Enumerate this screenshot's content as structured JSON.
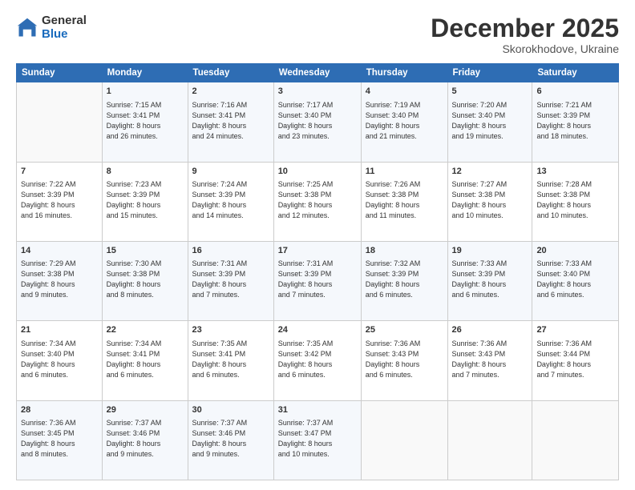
{
  "logo": {
    "general": "General",
    "blue": "Blue"
  },
  "title": "December 2025",
  "subtitle": "Skorokhodove, Ukraine",
  "days_header": [
    "Sunday",
    "Monday",
    "Tuesday",
    "Wednesday",
    "Thursday",
    "Friday",
    "Saturday"
  ],
  "weeks": [
    [
      {
        "day": "",
        "content": ""
      },
      {
        "day": "1",
        "content": "Sunrise: 7:15 AM\nSunset: 3:41 PM\nDaylight: 8 hours\nand 26 minutes."
      },
      {
        "day": "2",
        "content": "Sunrise: 7:16 AM\nSunset: 3:41 PM\nDaylight: 8 hours\nand 24 minutes."
      },
      {
        "day": "3",
        "content": "Sunrise: 7:17 AM\nSunset: 3:40 PM\nDaylight: 8 hours\nand 23 minutes."
      },
      {
        "day": "4",
        "content": "Sunrise: 7:19 AM\nSunset: 3:40 PM\nDaylight: 8 hours\nand 21 minutes."
      },
      {
        "day": "5",
        "content": "Sunrise: 7:20 AM\nSunset: 3:40 PM\nDaylight: 8 hours\nand 19 minutes."
      },
      {
        "day": "6",
        "content": "Sunrise: 7:21 AM\nSunset: 3:39 PM\nDaylight: 8 hours\nand 18 minutes."
      }
    ],
    [
      {
        "day": "7",
        "content": "Sunrise: 7:22 AM\nSunset: 3:39 PM\nDaylight: 8 hours\nand 16 minutes."
      },
      {
        "day": "8",
        "content": "Sunrise: 7:23 AM\nSunset: 3:39 PM\nDaylight: 8 hours\nand 15 minutes."
      },
      {
        "day": "9",
        "content": "Sunrise: 7:24 AM\nSunset: 3:39 PM\nDaylight: 8 hours\nand 14 minutes."
      },
      {
        "day": "10",
        "content": "Sunrise: 7:25 AM\nSunset: 3:38 PM\nDaylight: 8 hours\nand 12 minutes."
      },
      {
        "day": "11",
        "content": "Sunrise: 7:26 AM\nSunset: 3:38 PM\nDaylight: 8 hours\nand 11 minutes."
      },
      {
        "day": "12",
        "content": "Sunrise: 7:27 AM\nSunset: 3:38 PM\nDaylight: 8 hours\nand 10 minutes."
      },
      {
        "day": "13",
        "content": "Sunrise: 7:28 AM\nSunset: 3:38 PM\nDaylight: 8 hours\nand 10 minutes."
      }
    ],
    [
      {
        "day": "14",
        "content": "Sunrise: 7:29 AM\nSunset: 3:38 PM\nDaylight: 8 hours\nand 9 minutes."
      },
      {
        "day": "15",
        "content": "Sunrise: 7:30 AM\nSunset: 3:38 PM\nDaylight: 8 hours\nand 8 minutes."
      },
      {
        "day": "16",
        "content": "Sunrise: 7:31 AM\nSunset: 3:39 PM\nDaylight: 8 hours\nand 7 minutes."
      },
      {
        "day": "17",
        "content": "Sunrise: 7:31 AM\nSunset: 3:39 PM\nDaylight: 8 hours\nand 7 minutes."
      },
      {
        "day": "18",
        "content": "Sunrise: 7:32 AM\nSunset: 3:39 PM\nDaylight: 8 hours\nand 6 minutes."
      },
      {
        "day": "19",
        "content": "Sunrise: 7:33 AM\nSunset: 3:39 PM\nDaylight: 8 hours\nand 6 minutes."
      },
      {
        "day": "20",
        "content": "Sunrise: 7:33 AM\nSunset: 3:40 PM\nDaylight: 8 hours\nand 6 minutes."
      }
    ],
    [
      {
        "day": "21",
        "content": "Sunrise: 7:34 AM\nSunset: 3:40 PM\nDaylight: 8 hours\nand 6 minutes."
      },
      {
        "day": "22",
        "content": "Sunrise: 7:34 AM\nSunset: 3:41 PM\nDaylight: 8 hours\nand 6 minutes."
      },
      {
        "day": "23",
        "content": "Sunrise: 7:35 AM\nSunset: 3:41 PM\nDaylight: 8 hours\nand 6 minutes."
      },
      {
        "day": "24",
        "content": "Sunrise: 7:35 AM\nSunset: 3:42 PM\nDaylight: 8 hours\nand 6 minutes."
      },
      {
        "day": "25",
        "content": "Sunrise: 7:36 AM\nSunset: 3:43 PM\nDaylight: 8 hours\nand 6 minutes."
      },
      {
        "day": "26",
        "content": "Sunrise: 7:36 AM\nSunset: 3:43 PM\nDaylight: 8 hours\nand 7 minutes."
      },
      {
        "day": "27",
        "content": "Sunrise: 7:36 AM\nSunset: 3:44 PM\nDaylight: 8 hours\nand 7 minutes."
      }
    ],
    [
      {
        "day": "28",
        "content": "Sunrise: 7:36 AM\nSunset: 3:45 PM\nDaylight: 8 hours\nand 8 minutes."
      },
      {
        "day": "29",
        "content": "Sunrise: 7:37 AM\nSunset: 3:46 PM\nDaylight: 8 hours\nand 9 minutes."
      },
      {
        "day": "30",
        "content": "Sunrise: 7:37 AM\nSunset: 3:46 PM\nDaylight: 8 hours\nand 9 minutes."
      },
      {
        "day": "31",
        "content": "Sunrise: 7:37 AM\nSunset: 3:47 PM\nDaylight: 8 hours\nand 10 minutes."
      },
      {
        "day": "",
        "content": ""
      },
      {
        "day": "",
        "content": ""
      },
      {
        "day": "",
        "content": ""
      }
    ]
  ]
}
